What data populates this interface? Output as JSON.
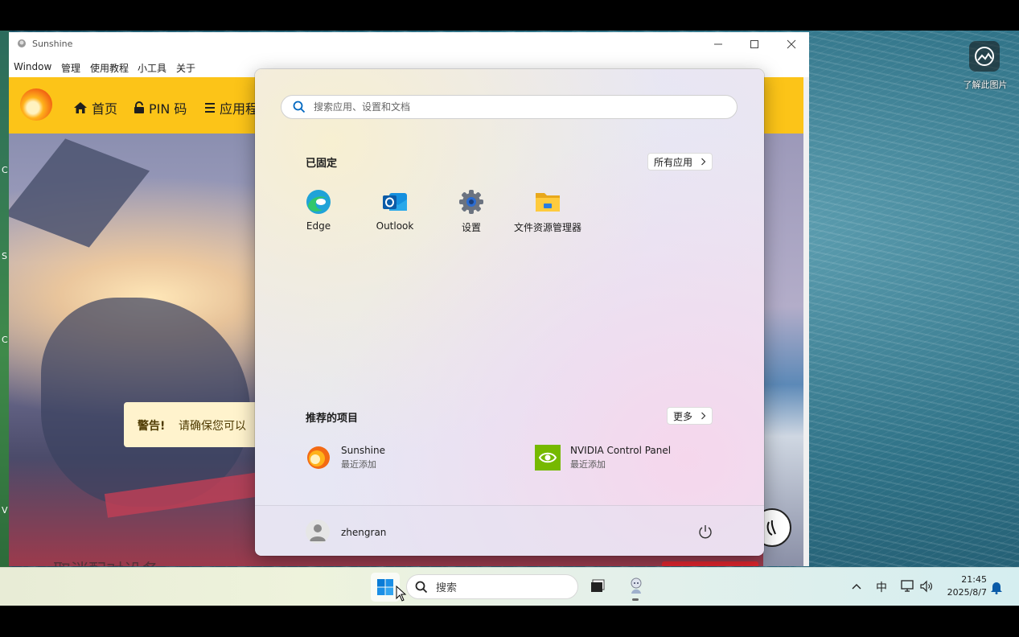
{
  "sunshine_window": {
    "title": "Sunshine",
    "menu": [
      "Window",
      "管理",
      "使用教程",
      "小工具",
      "关于"
    ],
    "nav": {
      "home": "首页",
      "pin": "PIN 码",
      "apps": "应用程"
    },
    "warning": {
      "bold": "警告!",
      "text": "请确保您可以"
    },
    "hero_bottom_text": "取消配对设备"
  },
  "desktop": {
    "lens_label": "了解此图片",
    "edge_chars": [
      "C",
      "S",
      "C",
      "V"
    ]
  },
  "start_menu": {
    "search_placeholder": "搜索应用、设置和文档",
    "pinned_title": "已固定",
    "all_apps_label": "所有应用",
    "pinned_apps": [
      "Edge",
      "Outlook",
      "设置",
      "文件资源管理器"
    ],
    "recommended_title": "推荐的项目",
    "more_label": "更多",
    "recommended": [
      {
        "name": "Sunshine",
        "sub": "最近添加"
      },
      {
        "name": "NVIDIA Control Panel",
        "sub": "最近添加"
      }
    ],
    "user": "zhengran"
  },
  "taskbar": {
    "search_label": "搜索",
    "ime": "中",
    "time": "21:45",
    "date": "2025/8/7"
  },
  "colors": {
    "accent": "#fcc418",
    "start_accent": "#0067c0"
  }
}
